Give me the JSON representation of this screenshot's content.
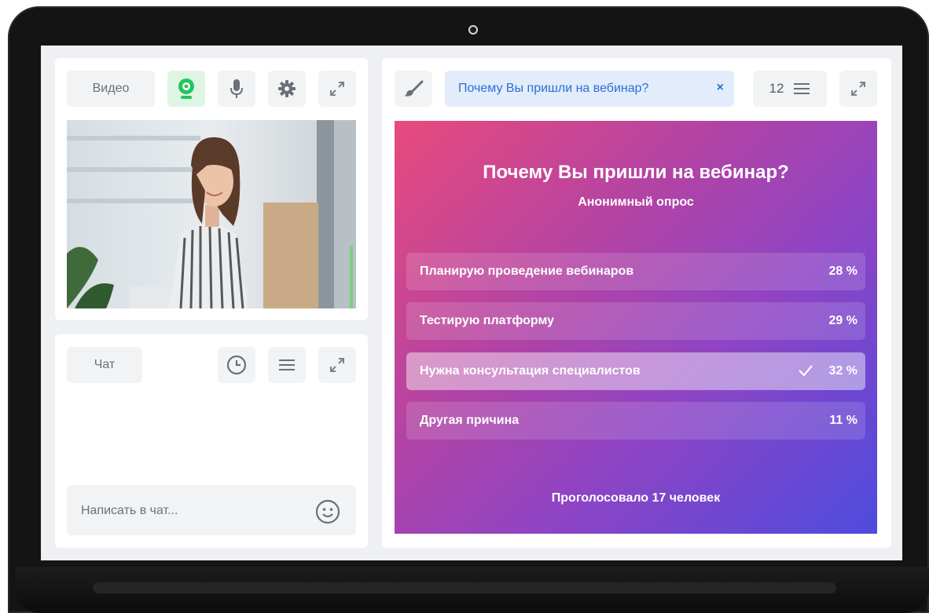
{
  "video_panel": {
    "tab_label": "Видео",
    "icons": [
      "webcam-icon",
      "microphone-icon",
      "gear-icon",
      "expand-icon"
    ],
    "accent_color": "#22c55e"
  },
  "chat_panel": {
    "tab_label": "Чат",
    "icons": [
      "clock-icon",
      "menu-icon",
      "expand-icon"
    ],
    "input_placeholder": "Написать в чат...",
    "emoji_icon": "smiley-icon"
  },
  "poll_panel": {
    "tab_title": "Почему Вы пришли на вебинар?",
    "tab_close": "×",
    "count": "12",
    "title": "Почему Вы пришли на вебинар?",
    "subtitle": "Анонимный опрос",
    "options": [
      {
        "label": "Планирую проведение вебинаров",
        "percent": "28 %",
        "value": 28,
        "selected": false
      },
      {
        "label": "Тестирую платформу",
        "percent": "29 %",
        "value": 29,
        "selected": false
      },
      {
        "label": "Нужна консультация специалистов",
        "percent": "32 %",
        "value": 32,
        "selected": true
      },
      {
        "label": "Другая причина",
        "percent": "11 %",
        "value": 11,
        "selected": false
      }
    ],
    "footer": "Проголосовало 17 человек",
    "gradient_colors": [
      "#e84a7c",
      "#4e4bde"
    ],
    "tab_accent": "#2b6fd6"
  }
}
